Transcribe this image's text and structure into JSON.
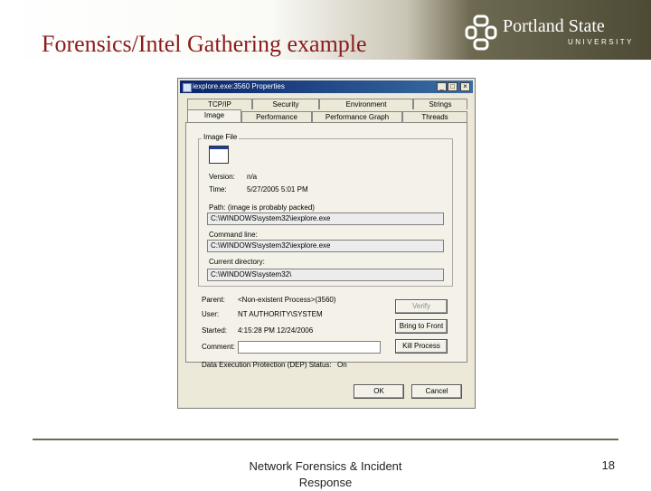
{
  "slide": {
    "title": "Forensics/Intel Gathering example",
    "logo": {
      "name": "Portland State",
      "sub": "UNIVERSITY"
    },
    "footer": "Network Forensics & Incident Response",
    "page_number": "18"
  },
  "dialog": {
    "title": "iexplore.exe:3560 Properties",
    "controls": {
      "minimize": "_",
      "maximize": "□",
      "close": "×"
    },
    "tabs_row1": [
      "TCP/IP",
      "Security",
      "Environment",
      "Strings"
    ],
    "tabs_row2": [
      "Image",
      "Performance",
      "Performance Graph",
      "Threads"
    ],
    "active_tab": "Image",
    "image_file_group": "Image File",
    "version_label": "Version:",
    "version_value": "n/a",
    "time_label": "Time:",
    "time_value": "5/27/2005 5:01 PM",
    "path_label": "Path: (image is probably packed)",
    "path_value": "C:\\WINDOWS\\system32\\iexplore.exe",
    "command_line_label": "Command line:",
    "command_line_value": "C:\\WINDOWS\\system32\\iexplore.exe",
    "current_directory_label": "Current directory:",
    "current_directory_value": "C:\\WINDOWS\\system32\\",
    "parent_label": "Parent:",
    "parent_value": "<Non-existent Process>(3560)",
    "user_label": "User:",
    "user_value": "NT AUTHORITY\\SYSTEM",
    "started_label": "Started:",
    "started_value": "4:15:28 PM   12/24/2006",
    "comment_label": "Comment:",
    "comment_value": "",
    "dep_label": "Data Execution Protection (DEP) Status:",
    "dep_value": "On",
    "buttons": {
      "verify": "Verify",
      "bring_to_front": "Bring to Front",
      "kill_process": "Kill Process",
      "ok": "OK",
      "cancel": "Cancel"
    }
  }
}
